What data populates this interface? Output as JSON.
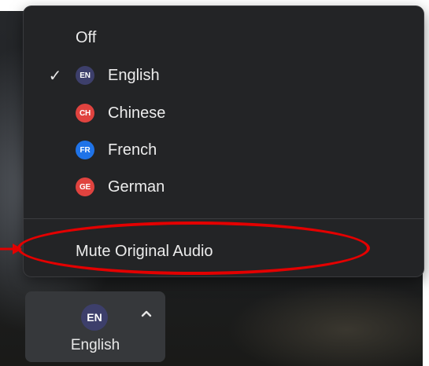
{
  "menu": {
    "items": [
      {
        "label": "Off",
        "badge": null,
        "checked": false
      },
      {
        "label": "English",
        "badge": "EN",
        "badge_color": "#3d3f6b",
        "checked": true
      },
      {
        "label": "Chinese",
        "badge": "CH",
        "badge_color": "#e0433f",
        "checked": false
      },
      {
        "label": "French",
        "badge": "FR",
        "badge_color": "#1f73e8",
        "checked": false
      },
      {
        "label": "German",
        "badge": "GE",
        "badge_color": "#e0433f",
        "checked": false
      }
    ],
    "mute_label": "Mute Original Audio",
    "check_glyph": "✓"
  },
  "button": {
    "badge": "EN",
    "label": "English"
  },
  "annotation": {
    "highlight_color": "#e30000"
  }
}
